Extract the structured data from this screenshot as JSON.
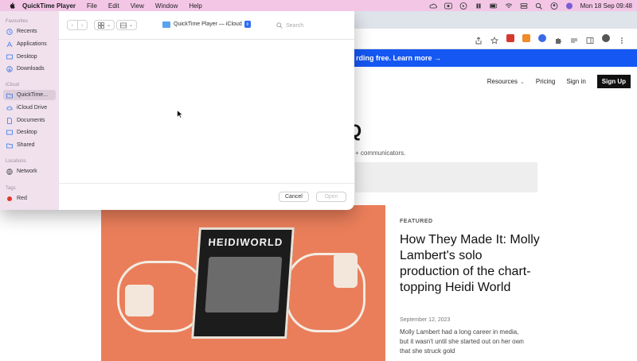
{
  "menubar": {
    "app_name": "QuickTime Player",
    "menus": [
      "File",
      "Edit",
      "View",
      "Window",
      "Help"
    ],
    "clock": "Mon 18 Sep  09:48"
  },
  "dialog": {
    "location": "QuickTime Player — iCloud",
    "search_placeholder": "Search",
    "cancel_label": "Cancel",
    "open_label": "Open",
    "sidebar": {
      "favourites_heading": "Favourites",
      "favourites": [
        "Recents",
        "Applications",
        "Desktop",
        "Downloads"
      ],
      "icloud_heading": "iCloud",
      "icloud": [
        "QuickTime...",
        "iCloud Drive",
        "Documents",
        "Desktop",
        "Shared"
      ],
      "locations_heading": "Locations",
      "locations": [
        "Network"
      ],
      "tags_heading": "Tags",
      "tags": [
        "Red"
      ],
      "tag_colors": [
        "#e0362c"
      ]
    }
  },
  "website": {
    "banner_text": "rding free. Learn more →",
    "nav": {
      "resources": "Resources",
      "pricing": "Pricing",
      "signin": "Sign in",
      "signup": "Sign Up"
    },
    "hero_fragment": "Q",
    "hero_sub_fragment": "+ communicators.",
    "featured_label": "FEATURED",
    "article_title": "How They Made It: Molly Lambert's solo production of the chart-topping Heidi World",
    "article_date": "September 12, 2023",
    "article_excerpt": "Molly Lambert had a long career in media, but it wasn't until she started out on her own that she struck gold",
    "image_box_text": "HEIDIWORLD"
  }
}
